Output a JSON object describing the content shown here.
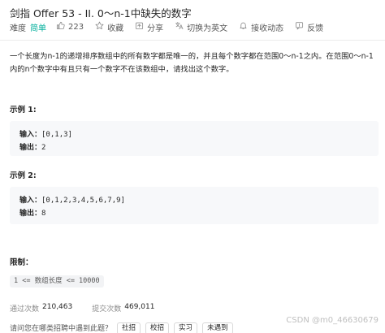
{
  "problem": {
    "title": "剑指 Offer 53 - II. 0～n-1中缺失的数字",
    "difficulty_label": "难度",
    "difficulty": "简单",
    "likes": "223",
    "actions": {
      "favorite": "收藏",
      "share": "分享",
      "switch_lang": "切换为英文",
      "notify": "接收动态",
      "feedback": "反馈"
    },
    "description": "一个长度为n-1的递增排序数组中的所有数字都是唯一的，并且每个数字都在范围0～n-1之内。在范围0～n-1内的n个数字中有且只有一个数字不在该数组中，请找出这个数字。"
  },
  "examples": [
    {
      "heading": "示例 1:",
      "input_label": "输入：",
      "input": "[0,1,3]",
      "output_label": "输出：",
      "output": "2"
    },
    {
      "heading": "示例 2:",
      "input_label": "输入：",
      "input": "[0,1,2,3,4,5,6,7,9]",
      "output_label": "输出：",
      "output": "8"
    }
  ],
  "constraints": {
    "heading": "限制：",
    "text": "1 <= 数组长度 <= 10000"
  },
  "stats": {
    "accepted_label": "通过次数",
    "accepted": "210,463",
    "submitted_label": "提交次数",
    "submitted": "469,011"
  },
  "bottom": {
    "question": "请问您在哪类招聘中遇到此题？",
    "tags": [
      "社招",
      "校招",
      "实习",
      "未遇到"
    ]
  },
  "watermark": "CSDN @m0_46630679",
  "colors": {
    "difficulty": "#00af9b",
    "codebox_bg": "#f7f8fa"
  }
}
